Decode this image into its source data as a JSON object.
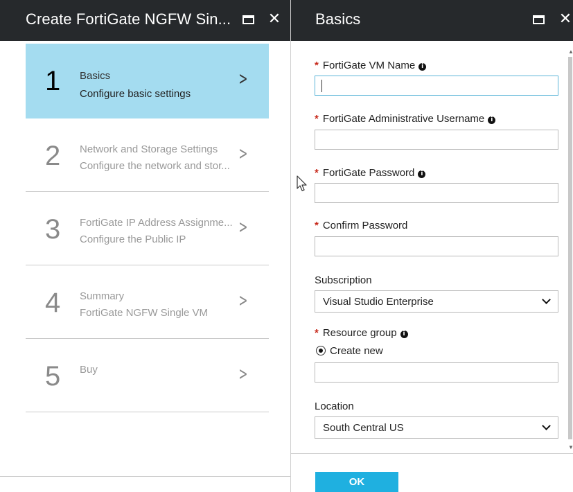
{
  "left_blade": {
    "title": "Create FortiGate NGFW Sin...",
    "steps": [
      {
        "num": "1",
        "label": "Basics",
        "sub": "Configure basic settings",
        "active": true
      },
      {
        "num": "2",
        "label": "Network and Storage Settings",
        "sub": "Configure the network and stor..."
      },
      {
        "num": "3",
        "label": "FortiGate IP Address Assignme...",
        "sub": "Configure the Public IP"
      },
      {
        "num": "4",
        "label": "Summary",
        "sub": "FortiGate NGFW Single VM"
      },
      {
        "num": "5",
        "label": "Buy",
        "sub": ""
      }
    ]
  },
  "right_blade": {
    "title": "Basics",
    "fields": {
      "vm_name": {
        "label": "FortiGate VM Name",
        "value": ""
      },
      "admin_username": {
        "label": "FortiGate Administrative Username",
        "value": ""
      },
      "password": {
        "label": "FortiGate Password",
        "value": ""
      },
      "confirm_password": {
        "label": "Confirm Password",
        "value": ""
      },
      "subscription": {
        "label": "Subscription",
        "value": "Visual Studio Enterprise"
      },
      "resource_group": {
        "label": "Resource group",
        "radio_label": "Create new",
        "value": ""
      },
      "location": {
        "label": "Location",
        "value": "South Central US"
      }
    },
    "ok_label": "OK"
  },
  "icons": {
    "maximize": "maximize-icon",
    "close": "close-icon",
    "chevron": "chevron-right-icon",
    "info": "info-icon",
    "dropdown": "chevron-down-icon",
    "cursor": "mouse-pointer-icon"
  },
  "colors": {
    "titlebar": "#26292c",
    "active_step": "#a4dcf0",
    "required_asterisk": "#c7291b",
    "ok_button": "#1fb0e0",
    "focus_border": "#5ab4d8"
  }
}
